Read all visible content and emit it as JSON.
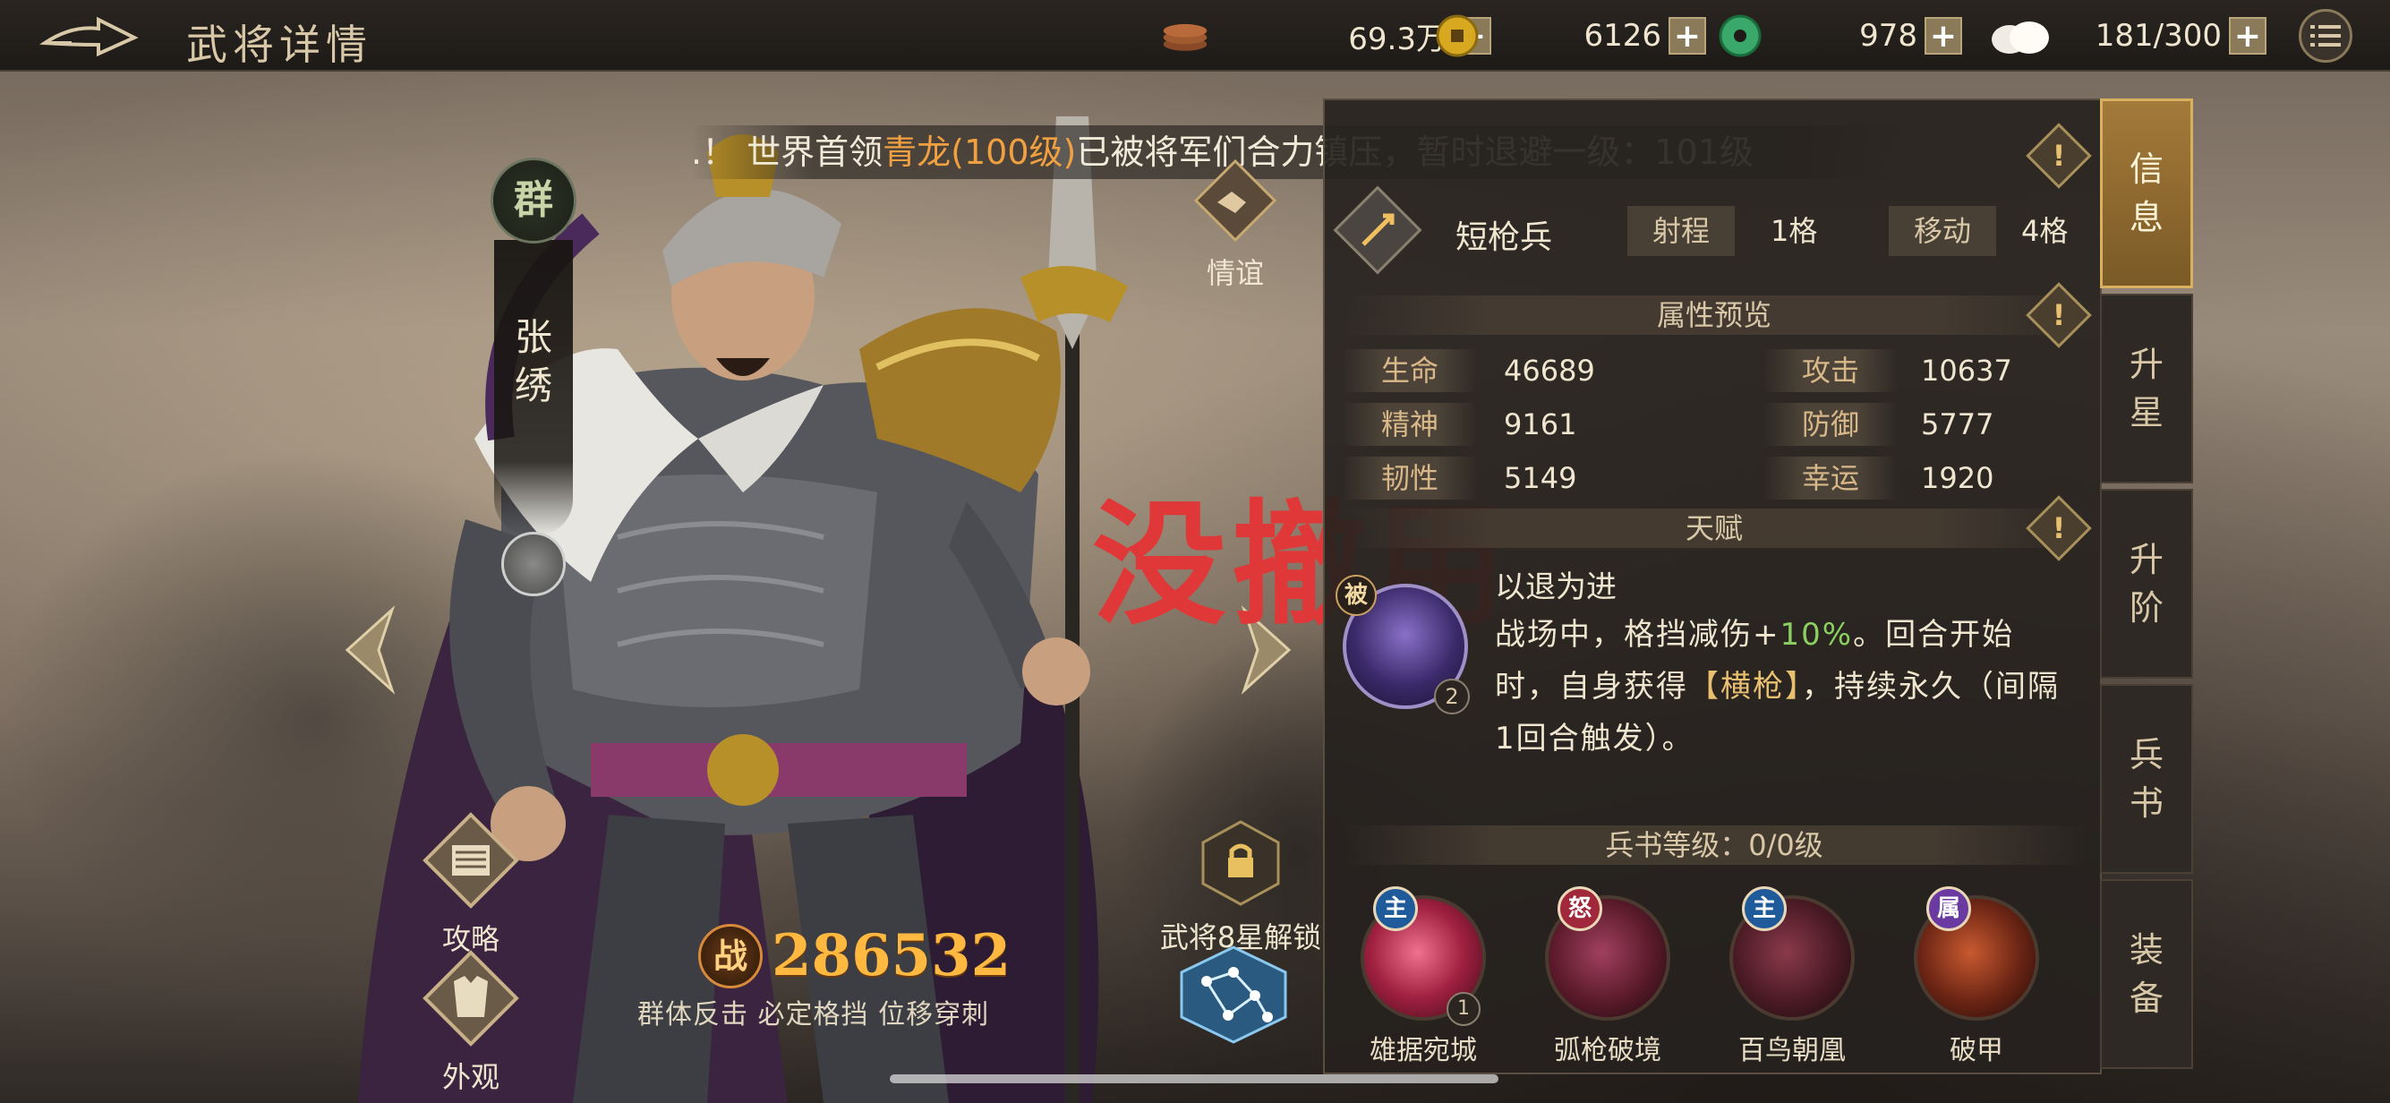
{
  "header": {
    "title": "武将详情",
    "resources": [
      {
        "icon": "copper-coins-icon",
        "value": "69.3万"
      },
      {
        "icon": "gold-coin-icon",
        "value": "6126"
      },
      {
        "icon": "jade-disc-icon",
        "value": "978"
      },
      {
        "icon": "steamed-bun-icon",
        "value": "181/300"
      }
    ],
    "plus_label": "+"
  },
  "notice": {
    "prefix": ".！ 世界首领",
    "highlight": "青龙(100级)",
    "suffix": "已被将军们合力镇压，暂时退避一级：101级"
  },
  "hero": {
    "faction": "群",
    "name": "张绣",
    "power_label": "战",
    "power": "286532",
    "traits": "群体反击 必定格挡 位移穿刺",
    "friendship_label": "情谊",
    "star_unlock_label": "武将8星解锁",
    "guide_label": "攻略",
    "appearance_label": "外观"
  },
  "overlay_text": "没撤用",
  "panel": {
    "unit": {
      "type": "短枪兵",
      "range_label": "射程",
      "range_value": "1格",
      "move_label": "移动",
      "move_value": "4格"
    },
    "attributes_title": "属性预览",
    "stats": [
      {
        "label": "生命",
        "value": "46689"
      },
      {
        "label": "攻击",
        "value": "10637"
      },
      {
        "label": "精神",
        "value": "9161"
      },
      {
        "label": "防御",
        "value": "5777"
      },
      {
        "label": "韧性",
        "value": "5149"
      },
      {
        "label": "幸运",
        "value": "1920"
      }
    ],
    "talent_title": "天赋",
    "talent": {
      "badge": "被",
      "level": "2",
      "name": "以退为进",
      "desc_1": "战场中，格挡减伤+",
      "desc_pct": "10%",
      "desc_2": "。回合开始时，自身获得",
      "desc_buff": "【横枪】",
      "desc_3": "，持续永久（间隔1回合触发）。"
    },
    "skillbook_title": "兵书等级：0/0级",
    "skills": [
      {
        "badge": "主",
        "name": "雄据宛城",
        "level": "1",
        "color": "#d84060",
        "badge_color": "#1f5a9a"
      },
      {
        "badge": "怒",
        "name": "弧枪破境",
        "level": "",
        "color": "#8a2a3a",
        "badge_color": "#a0283a"
      },
      {
        "badge": "主",
        "name": "百鸟朝凰",
        "level": "",
        "color": "#6a2a3a",
        "badge_color": "#1f5a9a"
      },
      {
        "badge": "属",
        "name": "破甲",
        "level": "",
        "color": "#8a3020",
        "badge_color": "#6a3aa0"
      }
    ],
    "tip_label": "!"
  },
  "tabs": [
    "信息",
    "升星",
    "升阶",
    "兵书",
    "装备"
  ]
}
